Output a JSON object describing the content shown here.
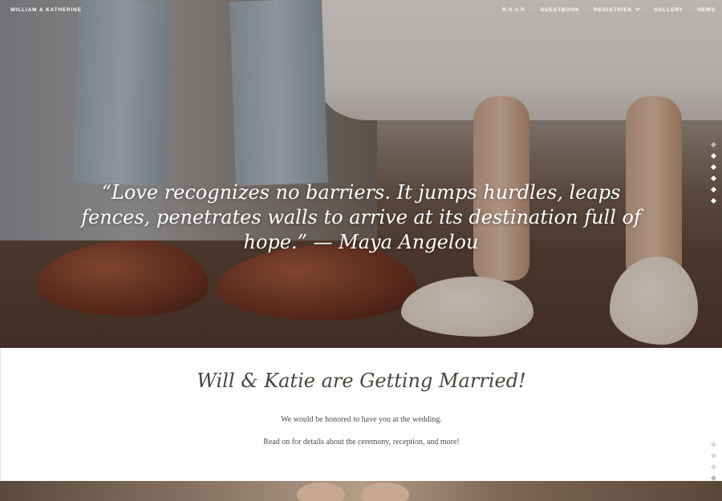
{
  "nav": {
    "brand": "WILLIAM & KATHERINE",
    "items": [
      {
        "label": "R.S.V.P."
      },
      {
        "label": "GUESTBOOK"
      },
      {
        "label": "REGISTRIES",
        "has_dropdown": true
      },
      {
        "label": "GALLERY"
      },
      {
        "label": "NEWS"
      }
    ]
  },
  "hero": {
    "quote": "“Love recognizes no barriers. It jumps hurdles, leaps fences, penetrates walls to arrive at its destination full of hope.” — Maya Angelou"
  },
  "intro": {
    "heading": "Will & Katie are Getting Married!",
    "line1": "We would be honored to have you at the wedding.",
    "line2": "Read on for details about the ceremony, reception, and more!"
  },
  "colors": {
    "heading": "#4a4540",
    "body_text": "#4c4c4c",
    "nav_text": "#ffffff"
  },
  "icons": {
    "dropdown": "chevron-down-icon",
    "section_nav": "diamond-dot-icon"
  }
}
